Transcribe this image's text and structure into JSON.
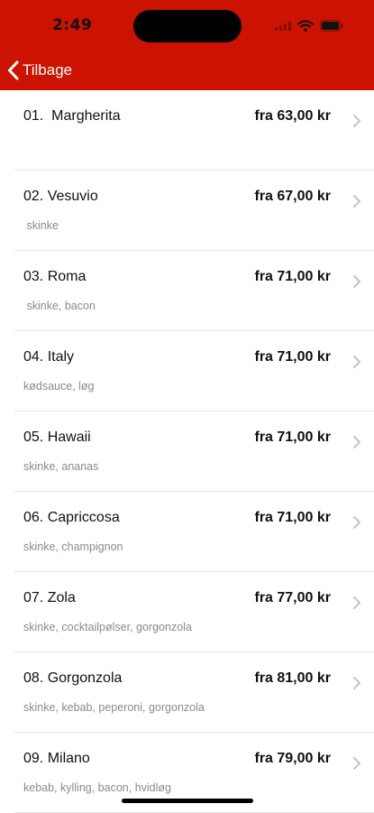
{
  "status_bar": {
    "time": "2:49"
  },
  "nav": {
    "back_label": "Tilbage"
  },
  "colors": {
    "header": "#cc1200",
    "text": "#111111",
    "secondary": "#8a8a8a",
    "separator": "#e6e6e6"
  },
  "menu": {
    "items": [
      {
        "name": "01.  Margherita",
        "desc": "",
        "price": "fra 63,00 kr"
      },
      {
        "name": "02. Vesuvio",
        "desc": " skinke",
        "price": "fra 67,00 kr"
      },
      {
        "name": "03. Roma",
        "desc": " skinke, bacon",
        "price": "fra 71,00 kr"
      },
      {
        "name": "04. Italy",
        "desc": "kødsauce, løg",
        "price": "fra 71,00 kr"
      },
      {
        "name": "05. Hawaii",
        "desc": "skinke, ananas",
        "price": "fra 71,00 kr"
      },
      {
        "name": "06. Capriccosa",
        "desc": "skinke, champignon",
        "price": "fra 71,00 kr"
      },
      {
        "name": "07. Zola",
        "desc": "skinke, cocktailpølser, gorgonzola",
        "price": "fra 77,00 kr"
      },
      {
        "name": "08. Gorgonzola",
        "desc": "skinke, kebab, peperoni, gorgonzola",
        "price": "fra 81,00 kr"
      },
      {
        "name": "09. Milano",
        "desc": "kebab, kylling, bacon, hvidløg",
        "price": "fra 79,00 kr"
      }
    ]
  }
}
